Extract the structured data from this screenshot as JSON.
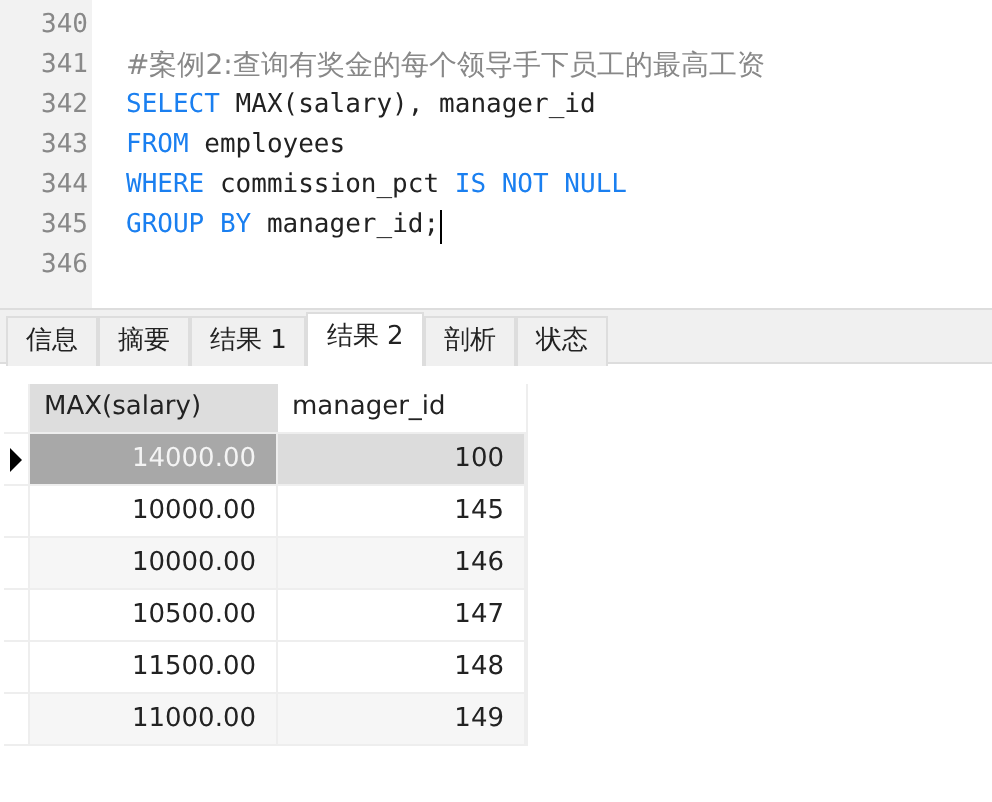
{
  "editor": {
    "lines": [
      {
        "number": "340",
        "cursor": false
      },
      {
        "number": "341",
        "tokens": [
          {
            "text": "#案例2:查询有奖金的每个领导手下员工的最高工资",
            "kind": "comment"
          }
        ],
        "cursor": false
      },
      {
        "number": "342",
        "tokens": [
          {
            "text": "SELECT",
            "kind": "keyword"
          },
          {
            "text": " MAX(salary), manager_id",
            "kind": "plain"
          }
        ],
        "cursor": false
      },
      {
        "number": "343",
        "tokens": [
          {
            "text": "FROM",
            "kind": "keyword"
          },
          {
            "text": " employees",
            "kind": "plain"
          }
        ],
        "cursor": false
      },
      {
        "number": "344",
        "tokens": [
          {
            "text": "WHERE",
            "kind": "keyword"
          },
          {
            "text": " commission_pct ",
            "kind": "plain"
          },
          {
            "text": "IS NOT NULL",
            "kind": "keyword"
          }
        ],
        "cursor": false
      },
      {
        "number": "345",
        "tokens": [
          {
            "text": "GROUP BY",
            "kind": "keyword"
          },
          {
            "text": " manager_id;",
            "kind": "plain"
          }
        ],
        "cursor": true
      },
      {
        "number": "346",
        "cursor": false
      }
    ]
  },
  "tabs": [
    {
      "label": "信息",
      "selected": false
    },
    {
      "label": "摘要",
      "selected": false
    },
    {
      "label": "结果 1",
      "selected": false
    },
    {
      "label": "结果 2",
      "selected": true
    },
    {
      "label": "剖析",
      "selected": false
    },
    {
      "label": "状态",
      "selected": false
    }
  ],
  "table": {
    "columns": [
      "MAX(salary)",
      "manager_id"
    ],
    "rows": [
      {
        "cells": [
          "14000.00",
          "100"
        ],
        "selected": true
      },
      {
        "cells": [
          "10000.00",
          "145"
        ],
        "selected": false
      },
      {
        "cells": [
          "10000.00",
          "146"
        ],
        "selected": false
      },
      {
        "cells": [
          "10500.00",
          "147"
        ],
        "selected": false
      },
      {
        "cells": [
          "11500.00",
          "148"
        ],
        "selected": false
      },
      {
        "cells": [
          "11000.00",
          "149"
        ],
        "selected": false
      }
    ]
  }
}
